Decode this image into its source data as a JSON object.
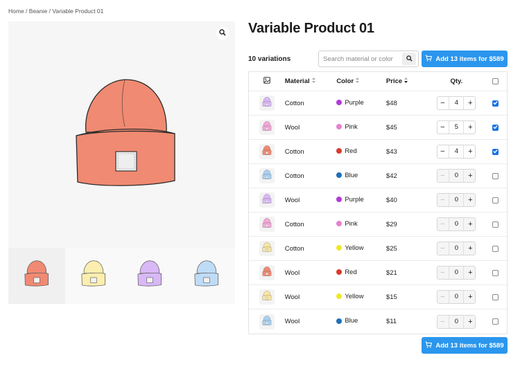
{
  "breadcrumb": {
    "home": "Home",
    "sep": " / ",
    "category": "Beanie",
    "current": "Variable Product 01"
  },
  "product": {
    "title": "Variable Product 01"
  },
  "gallery": {
    "main_color": "#f08a72",
    "thumbs": [
      {
        "color": "#f08a72",
        "active": true
      },
      {
        "color": "#fbeeb0",
        "active": false
      },
      {
        "color": "#d9b8f6",
        "active": false
      },
      {
        "color": "#bfdcf6",
        "active": false
      }
    ]
  },
  "toolbar": {
    "variations_count": "10 variations",
    "search_placeholder": "Search material or color",
    "add_label": "Add 13 items for $589"
  },
  "table": {
    "headers": {
      "material": "Material",
      "color": "Color",
      "price": "Price",
      "qty": "Qty."
    },
    "rows": [
      {
        "material": "Cotton",
        "color": "Purple",
        "dot": "#b23bd6",
        "swatch": "#d9b8f6",
        "price": "$48",
        "qty": "4",
        "checked": true
      },
      {
        "material": "Wool",
        "color": "Pink",
        "dot": "#e680d0",
        "swatch": "#f4a8d8",
        "price": "$45",
        "qty": "5",
        "checked": true
      },
      {
        "material": "Cotton",
        "color": "Red",
        "dot": "#d93a2f",
        "swatch": "#f08a72",
        "price": "$43",
        "qty": "4",
        "checked": true
      },
      {
        "material": "Cotton",
        "color": "Blue",
        "dot": "#1f6fb8",
        "swatch": "#a9d0f2",
        "price": "$42",
        "qty": "0",
        "checked": false
      },
      {
        "material": "Wool",
        "color": "Purple",
        "dot": "#b23bd6",
        "swatch": "#d9b8f6",
        "price": "$40",
        "qty": "0",
        "checked": false
      },
      {
        "material": "Cotton",
        "color": "Pink",
        "dot": "#e680d0",
        "swatch": "#f4a8d8",
        "price": "$29",
        "qty": "0",
        "checked": false
      },
      {
        "material": "Cotton",
        "color": "Yellow",
        "dot": "#f2e628",
        "swatch": "#f8e6a0",
        "price": "$25",
        "qty": "0",
        "checked": false
      },
      {
        "material": "Wool",
        "color": "Red",
        "dot": "#d93a2f",
        "swatch": "#f08a72",
        "price": "$21",
        "qty": "0",
        "checked": false
      },
      {
        "material": "Wool",
        "color": "Yellow",
        "dot": "#f2e628",
        "swatch": "#f8e6a0",
        "price": "$15",
        "qty": "0",
        "checked": false
      },
      {
        "material": "Wool",
        "color": "Blue",
        "dot": "#1f6fb8",
        "swatch": "#a9d0f2",
        "price": "$11",
        "qty": "0",
        "checked": false
      }
    ]
  },
  "colors": {
    "accent": "#2b96ed",
    "checkbox": "#1a73e8"
  }
}
